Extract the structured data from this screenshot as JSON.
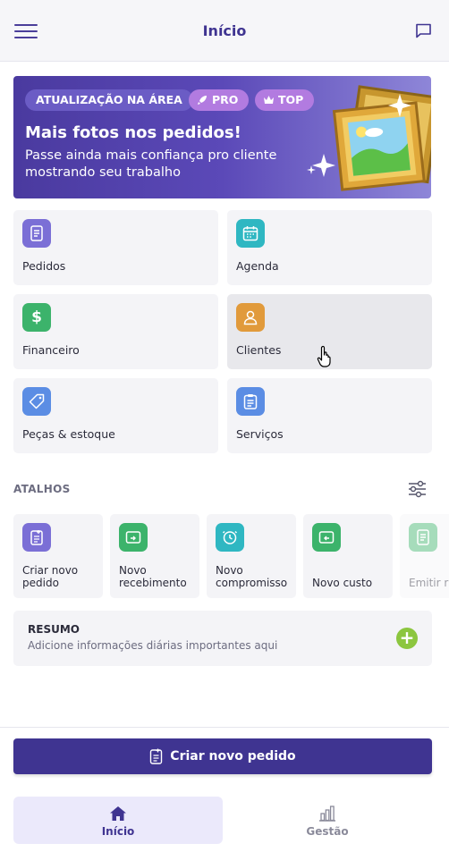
{
  "header": {
    "title": "Início",
    "menu_icon": "hamburger-menu-icon",
    "chat_icon": "chat-bubble-icon"
  },
  "banner": {
    "chip_area": "ATUALIZAÇÃO NA ÁREA",
    "chip_pro": "PRO",
    "chip_top": "TOP",
    "title": "Mais fotos nos pedidos!",
    "subtitle": "Passe ainda mais confiança pro cliente mostrando seu trabalho"
  },
  "tiles": [
    {
      "label": "Pedidos",
      "icon": "document-icon",
      "color": "#7b6fd6"
    },
    {
      "label": "Agenda",
      "icon": "calendar-icon",
      "color": "#2fb7c2"
    },
    {
      "label": "Financeiro",
      "icon": "dollar-icon",
      "color": "#3cb36b"
    },
    {
      "label": "Clientes",
      "icon": "person-icon",
      "color": "#e19a3b"
    },
    {
      "label": "Peças & estoque",
      "icon": "tag-icon",
      "color": "#5b8de4"
    },
    {
      "label": "Serviços",
      "icon": "clipboard-icon",
      "color": "#5b8de4"
    }
  ],
  "shortcuts": {
    "title": "ATALHOS",
    "settings_icon": "sliders-icon",
    "items": [
      {
        "label": "Criar novo pedido",
        "icon": "new-document-icon",
        "color": "#7b6fd6"
      },
      {
        "label": "Novo recebimento",
        "icon": "money-in-icon",
        "color": "#3cb36b"
      },
      {
        "label": "Novo compromisso",
        "icon": "clock-icon",
        "color": "#2fb7c2"
      },
      {
        "label": "Novo custo",
        "icon": "money-out-icon",
        "color": "#3cb36b"
      },
      {
        "label": "Emitir r",
        "icon": "receipt-icon",
        "color": "#3cb36b"
      }
    ]
  },
  "resumo": {
    "title": "RESUMO",
    "subtitle": "Adicione informações diárias importantes aqui"
  },
  "cta": {
    "label": "Criar novo pedido"
  },
  "bottom_nav": {
    "home": "Início",
    "manage": "Gestão"
  },
  "colors": {
    "primary": "#3f3491",
    "accent_green": "#8cc63f"
  }
}
